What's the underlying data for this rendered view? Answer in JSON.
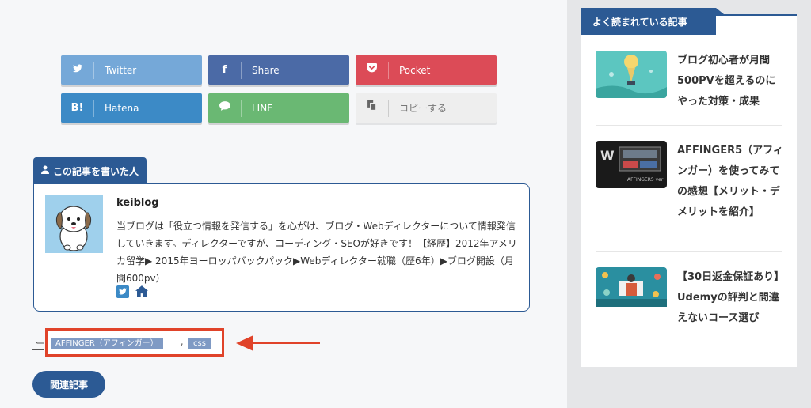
{
  "share": {
    "twitter": "Twitter",
    "facebook": "Share",
    "pocket": "Pocket",
    "hatena": "Hatena",
    "hatena_icon": "B!",
    "line": "LINE",
    "copy": "コピーする"
  },
  "author": {
    "tab_label": "この記事を書いた人",
    "name": "keiblog",
    "description": "当ブログは「役立つ情報を発信する」を心がけ、ブログ・Webディレクターについて情報発信していきます。ディレクターですが、コーディング・SEOが好きです！【経歴】2012年アメリカ留学▶ 2015年ヨーロッパバックパック▶Webディレクター就職（歴6年）▶ブログ開設（月間600pv）"
  },
  "tags": {
    "items": [
      "AFFINGER（アフィンガー）",
      "css"
    ],
    "separator": ","
  },
  "related_button": "関連記事",
  "sidebar": {
    "title": "よく読まれている記事",
    "posts": [
      {
        "title": "ブログ初心者が月間500PVを超えるのにやった対策・成果"
      },
      {
        "title": "AFFINGER5（アフィンガー）を使ってみての感想【メリット・デメリットを紹介】",
        "thumb_text": "AFFINGER5 ver"
      },
      {
        "title": "【30日返金保証あり】Udemyの評判と間違えないコース選び"
      }
    ]
  },
  "colors": {
    "brand": "#2c5a94",
    "highlight": "#e0432a",
    "twitter": "#75a8d8",
    "facebook": "#4b6aa6",
    "pocket": "#dc4b57",
    "hatena": "#3c8ac6",
    "line": "#6ab873"
  }
}
